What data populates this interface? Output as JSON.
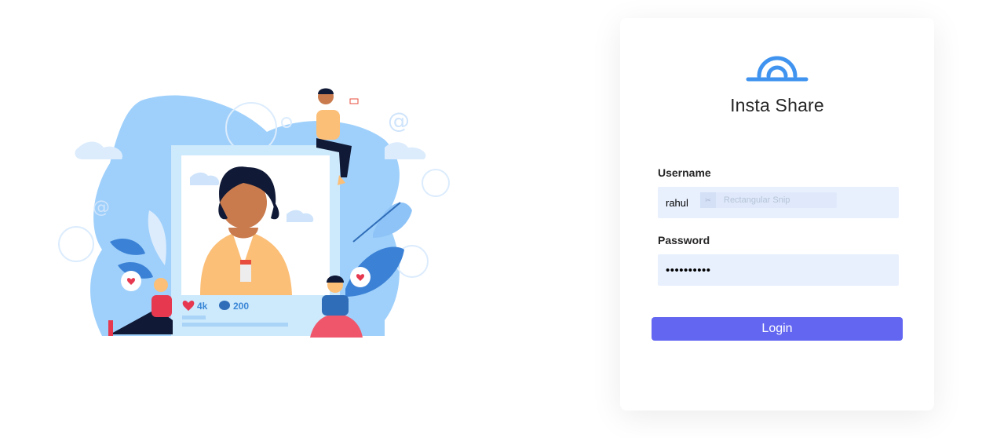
{
  "app": {
    "title": "Insta Share",
    "logo_icon": "insta-share-logo-icon"
  },
  "login_form": {
    "username_label": "Username",
    "username_value": "rahul",
    "autofill_suggestion": "Rectangular Snip",
    "password_label": "Password",
    "password_value": "••••••••••",
    "login_button_label": "Login"
  },
  "illustration": {
    "like_count": "4k",
    "comment_count": "200",
    "icons": [
      "heart-icon",
      "comment-icon",
      "at-sign-icon"
    ]
  },
  "colors": {
    "accent": "#6366f1",
    "logo_blue": "#4094ef",
    "field_bg": "#e8f0fe",
    "text_dark": "#262626"
  }
}
